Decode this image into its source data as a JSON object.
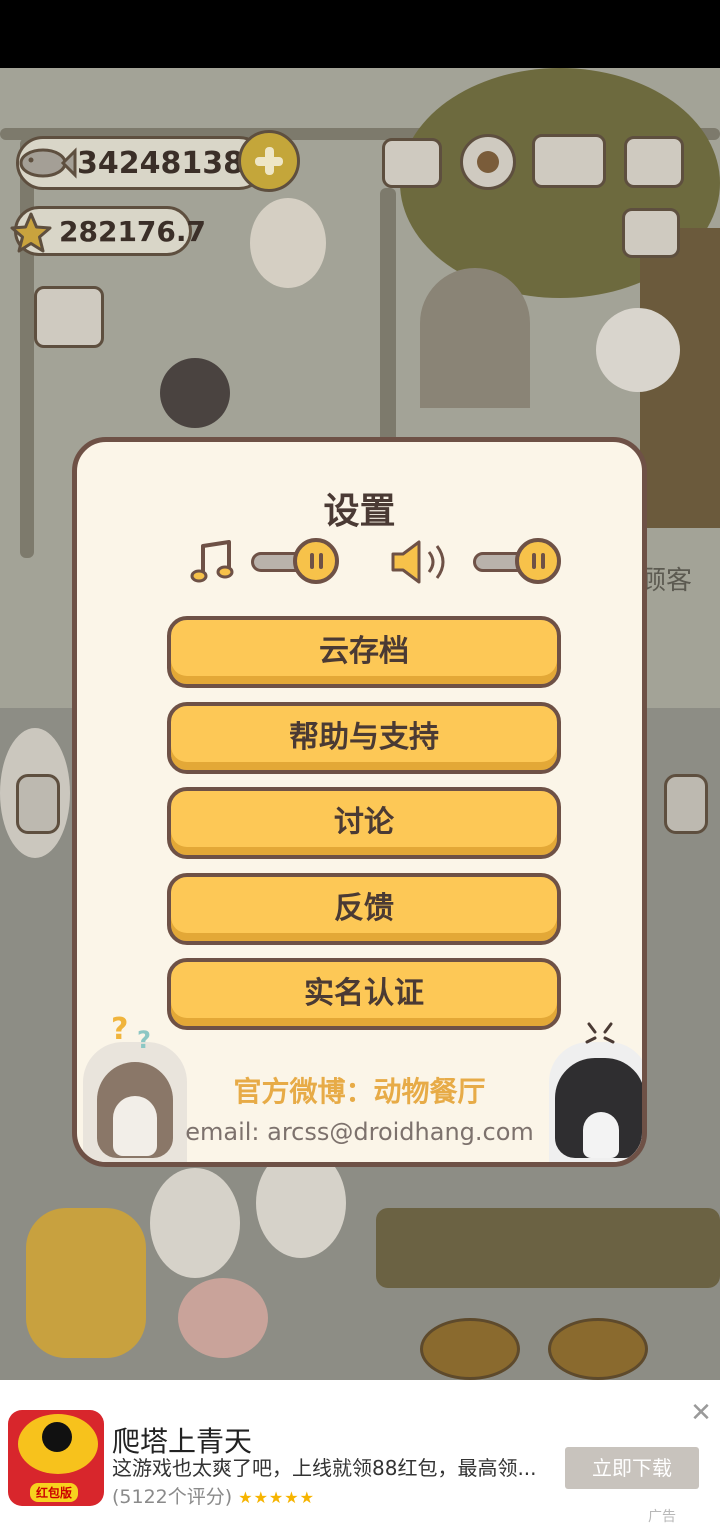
{
  "hud": {
    "fish_count": "342481389",
    "star_count": "282176.7"
  },
  "background": {
    "side_text": "顾客"
  },
  "settings": {
    "title": "设置",
    "music_on": true,
    "sound_on": true,
    "buttons": [
      "云存档",
      "帮助与支持",
      "讨论",
      "反馈",
      "实名认证"
    ],
    "weibo": "官方微博：动物餐厅",
    "email": "email: arcss@droidhang.com",
    "deco_question": "?",
    "deco_question2": "?"
  },
  "ad": {
    "title": "爬塔上青天",
    "description": "这游戏也太爽了吧，上线就领88红包，最高领...",
    "rating_text": "(5122个评分)",
    "stars": "★★★★★",
    "button": "立即下载",
    "close": "✕",
    "tag": "广告",
    "icon_badge": "红包版"
  },
  "colors": {
    "button_fill": "#fdc856",
    "modal_border": "#6e5146",
    "weibo_text": "#e7ab47"
  }
}
